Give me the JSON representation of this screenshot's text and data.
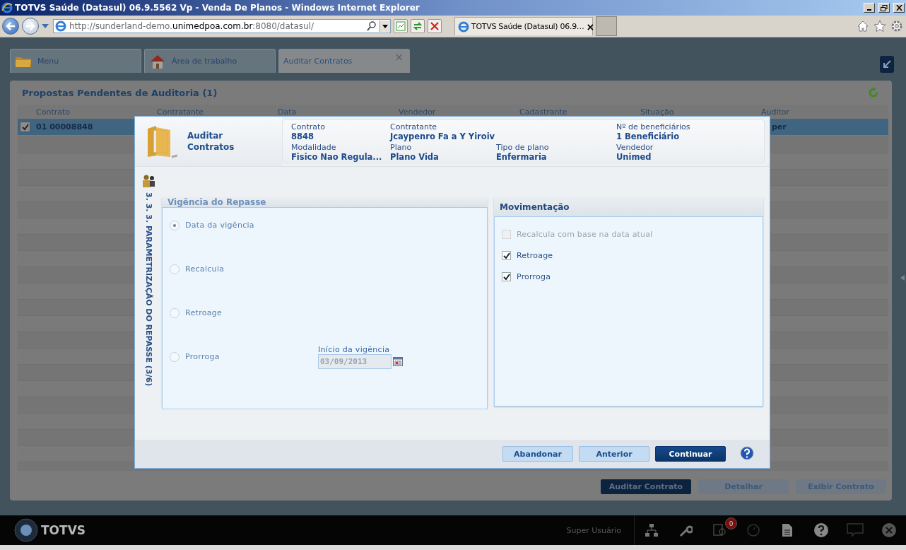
{
  "browser": {
    "title": "TOTVS Saúde (Datasul) 06.9.5562 Vp - Venda De Planos - Windows Internet Explorer",
    "address": [
      {
        "text": "http://sunderland-demo.",
        "strong": false
      },
      {
        "text": "unimedpoa.com.br",
        "strong": true
      },
      {
        "text": ":8080/datasul/",
        "strong": false
      }
    ],
    "tabs": [
      {
        "label": "TOTVS Saúde (Datasul) 06.9…",
        "selected": true,
        "close": "×"
      }
    ]
  },
  "app_tabs": [
    {
      "label": "Menu",
      "selected": false
    },
    {
      "label": "Área de trabalho",
      "selected": false
    },
    {
      "label": "Auditar Contratos",
      "selected": true,
      "close": "×"
    }
  ],
  "grid": {
    "title": "Propostas Pendentes de Auditoria (1)",
    "columns": [
      "Contrato",
      "Contratante",
      "Data",
      "Vendedor",
      "Cadastrante",
      "Situação",
      "Auditor"
    ],
    "rows": [
      {
        "checked": true,
        "selected": true,
        "cells": [
          "01 00008848",
          "",
          "",
          "",
          "",
          "",
          "per"
        ]
      }
    ]
  },
  "actions": [
    {
      "label": "Auditar Contrato",
      "primary": true
    },
    {
      "label": "Detalhar",
      "primary": false
    },
    {
      "label": "Exibir Contrato",
      "primary": false
    }
  ],
  "dialog": {
    "title": "Auditar Contratos",
    "info": [
      {
        "label": "Contrato",
        "value": "8848",
        "wide": false
      },
      {
        "label": "Contratante",
        "value": "Jcaypenro Fa a  Y  Yiroiv",
        "wide": true
      },
      {
        "label": "Nº de beneficiários",
        "value": "1 Beneficiário",
        "wide": false
      },
      {
        "label": "Modalidade",
        "value": "Fisico Nao Regula...",
        "wide": false
      },
      {
        "label": "Plano",
        "value": "Plano Vida",
        "wide": false
      },
      {
        "label": "Tipo de plano",
        "value": "Enfermaria",
        "wide": false
      },
      {
        "label": "Vendedor",
        "value": "Unimed",
        "wide": false
      }
    ],
    "step": "3. 3. 3. PARAMETRIZAÇÃO DO REPASSE (3/6)",
    "vigencia": {
      "title": "Vigência do Repasse",
      "disabled": true,
      "options": [
        {
          "label": "Data da vigência",
          "selected": true
        },
        {
          "label": "Recalcula",
          "selected": false
        },
        {
          "label": "Retroage",
          "selected": false
        },
        {
          "label": "Prorroga",
          "selected": false
        }
      ],
      "date_field": {
        "label": "Início da vigência",
        "value": "03/09/2013",
        "disabled": true
      }
    },
    "movimentacao": {
      "title": "Movimentação",
      "disabled": false,
      "checkboxes": [
        {
          "label": "Recalcula com base na data atual",
          "checked": false,
          "disabled": true
        },
        {
          "label": "Retroage",
          "checked": true,
          "disabled": false
        },
        {
          "label": "Prorroga",
          "checked": true,
          "disabled": false
        }
      ]
    },
    "buttons": [
      {
        "label": "Abandonar",
        "primary": false
      },
      {
        "label": "Anterior",
        "primary": false
      },
      {
        "label": "Continuar",
        "primary": true
      }
    ]
  },
  "taskbar": {
    "logo": "TOTVS",
    "user": "Super Usuário",
    "badge": "0"
  }
}
